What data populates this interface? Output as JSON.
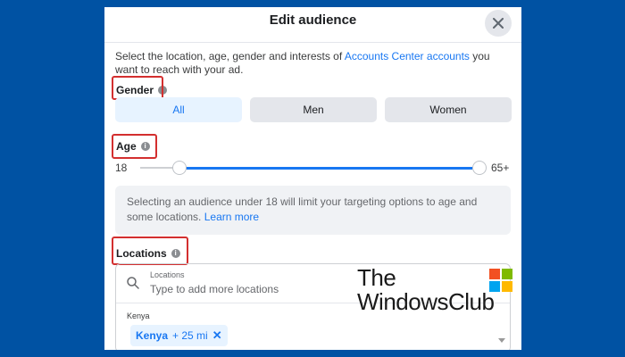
{
  "dialog": {
    "title": "Edit audience",
    "close_icon": "close-icon",
    "intro_prefix": "Select the location, age, gender and interests of ",
    "intro_link": "Accounts Center accounts",
    "intro_suffix": " you want to reach with your ad."
  },
  "gender": {
    "label": "Gender",
    "options": [
      "All",
      "Men",
      "Women"
    ],
    "selected": "All"
  },
  "age": {
    "label": "Age",
    "min_value": "18",
    "max_value": "65+"
  },
  "notice": {
    "text": "Selecting an audience under 18 will limit your targeting options to age and some locations. ",
    "link": "Learn more"
  },
  "locations": {
    "label": "Locations",
    "field_label": "Locations",
    "placeholder": "Type to add more locations",
    "country": "Kenya",
    "chip_name": "Kenya",
    "chip_radius": "+ 25 mi",
    "chip_remove": "✕"
  },
  "watermark": {
    "line1": "The",
    "line2": "WindowsClub"
  },
  "colors": {
    "background": "#0052a3",
    "accent": "#1877f2",
    "highlight_box": "#d32f2f"
  }
}
